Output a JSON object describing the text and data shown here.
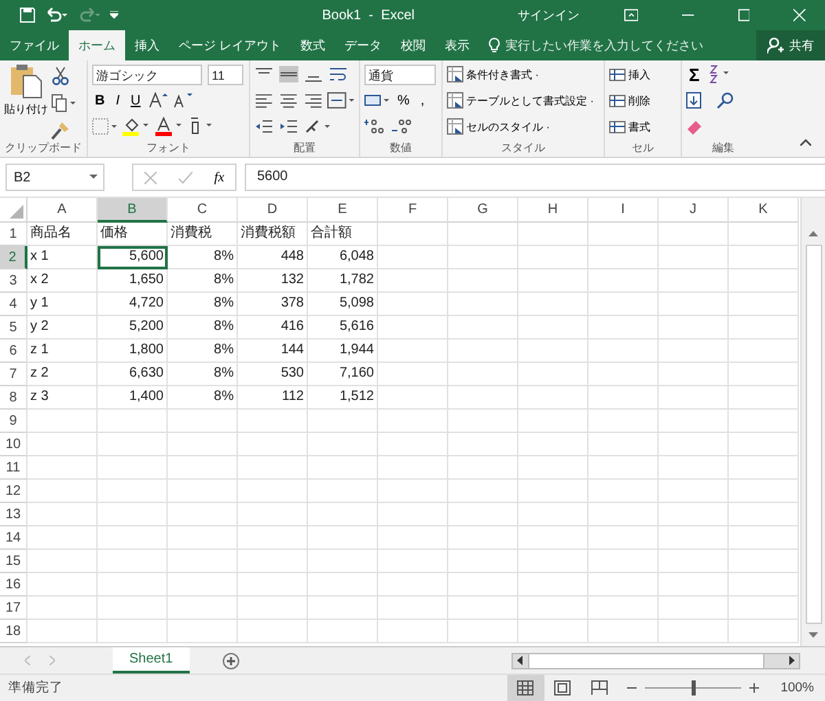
{
  "window": {
    "title": "Book1  -  Excel",
    "signin": "サインイン"
  },
  "tabs": [
    {
      "label": "ファイル",
      "selected": false
    },
    {
      "label": "ホーム",
      "selected": true
    },
    {
      "label": "挿入",
      "selected": false
    },
    {
      "label": "ページ レイアウト",
      "selected": false
    },
    {
      "label": "数式",
      "selected": false
    },
    {
      "label": "データ",
      "selected": false
    },
    {
      "label": "校閲",
      "selected": false
    },
    {
      "label": "表示",
      "selected": false
    }
  ],
  "tell_me": {
    "placeholder": "実行したい作業を入力してください"
  },
  "share": "共有",
  "ribbon": {
    "clipboard": {
      "paste": "貼り付け",
      "label": "クリップボード"
    },
    "font": {
      "name": "游ゴシック",
      "size": "11",
      "bold": "B",
      "italic": "I",
      "underline": "U",
      "label": "フォント"
    },
    "alignment": {
      "label": "配置"
    },
    "number": {
      "format": "通貨",
      "percent": "%",
      "comma": ",",
      "label": "数値"
    },
    "styles": {
      "items": [
        "条件付き書式 ·",
        "テーブルとして書式設定 ·",
        "セルのスタイル ·"
      ],
      "label": "スタイル"
    },
    "cells": {
      "items": [
        "挿入",
        "削除",
        "書式"
      ],
      "label": "セル"
    },
    "editing": {
      "sum": "Σ",
      "label": "編集"
    }
  },
  "formula_bar": {
    "name_box": "B2",
    "fx": "fx",
    "value": "5600"
  },
  "sheet": {
    "columns": [
      {
        "label": "A",
        "selected": false
      },
      {
        "label": "B",
        "selected": true
      },
      {
        "label": "C",
        "selected": false
      },
      {
        "label": "D",
        "selected": false
      },
      {
        "label": "E",
        "selected": false
      },
      {
        "label": "F",
        "selected": false
      },
      {
        "label": "G",
        "selected": false
      },
      {
        "label": "H",
        "selected": false
      },
      {
        "label": "I",
        "selected": false
      },
      {
        "label": "J",
        "selected": false
      },
      {
        "label": "K",
        "selected": false
      }
    ],
    "rows": [
      {
        "label": "1",
        "selected": false,
        "cells": [
          "商品名",
          "価格",
          "消費税",
          "消費税額",
          "合計額"
        ]
      },
      {
        "label": "2",
        "selected": true,
        "cells": [
          "x 1",
          "5,600",
          "8%",
          "448",
          "6,048"
        ]
      },
      {
        "label": "3",
        "selected": false,
        "cells": [
          "x 2",
          "1,650",
          "8%",
          "132",
          "1,782"
        ]
      },
      {
        "label": "4",
        "selected": false,
        "cells": [
          "y 1",
          "4,720",
          "8%",
          "378",
          "5,098"
        ]
      },
      {
        "label": "5",
        "selected": false,
        "cells": [
          "y 2",
          "5,200",
          "8%",
          "416",
          "5,616"
        ]
      },
      {
        "label": "6",
        "selected": false,
        "cells": [
          "z 1",
          "1,800",
          "8%",
          "144",
          "1,944"
        ]
      },
      {
        "label": "7",
        "selected": false,
        "cells": [
          "z 2",
          "6,630",
          "8%",
          "530",
          "7,160"
        ]
      },
      {
        "label": "8",
        "selected": false,
        "cells": [
          "z 3",
          "1,400",
          "8%",
          "112",
          "1,512"
        ]
      },
      {
        "label": "9",
        "selected": false,
        "cells": []
      },
      {
        "label": "10",
        "selected": false,
        "cells": []
      },
      {
        "label": "11",
        "selected": false,
        "cells": []
      },
      {
        "label": "12",
        "selected": false,
        "cells": []
      },
      {
        "label": "13",
        "selected": false,
        "cells": []
      },
      {
        "label": "14",
        "selected": false,
        "cells": []
      },
      {
        "label": "15",
        "selected": false,
        "cells": []
      },
      {
        "label": "16",
        "selected": false,
        "cells": []
      },
      {
        "label": "17",
        "selected": false,
        "cells": []
      },
      {
        "label": "18",
        "selected": false,
        "cells": []
      }
    ]
  },
  "sheet_tabs": [
    {
      "label": "Sheet1",
      "selected": true
    }
  ],
  "status_bar": {
    "text": "準備完了",
    "zoom": "100%",
    "zoom_slider": {
      "level": 0.5
    },
    "views": [
      {
        "kind": "normal",
        "selected": true
      },
      {
        "kind": "page-layout",
        "selected": false
      },
      {
        "kind": "page-break",
        "selected": false
      }
    ]
  }
}
